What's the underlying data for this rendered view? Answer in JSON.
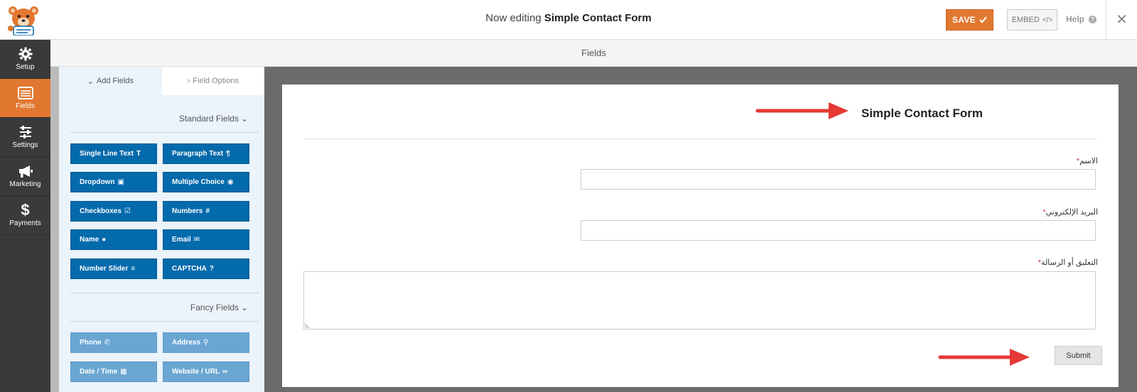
{
  "header": {
    "title_prefix": "Now editing",
    "title_form": "Simple Contact Form",
    "save_label": "SAVE",
    "embed_label": "EMBED",
    "help_label": "Help"
  },
  "sidebar": {
    "items": [
      {
        "label": "Setup",
        "icon": "gear-icon",
        "active": false
      },
      {
        "label": "Fields",
        "icon": "list-icon",
        "active": true
      },
      {
        "label": "Settings",
        "icon": "sliders-icon",
        "active": false
      },
      {
        "label": "Marketing",
        "icon": "megaphone-icon",
        "active": false
      },
      {
        "label": "Payments",
        "icon": "dollar-icon",
        "active": false
      }
    ]
  },
  "fields_header": "Fields",
  "panel": {
    "tabs": [
      {
        "label": "Add Fields",
        "active": true
      },
      {
        "label": "Field Options",
        "active": false
      }
    ],
    "standard_title": "Standard Fields",
    "fancy_title": "Fancy Fields",
    "standard_fields": [
      {
        "label": "Single Line Text",
        "icon": "text-cursor-icon"
      },
      {
        "label": "Paragraph Text",
        "icon": "pilcrow-icon"
      },
      {
        "label": "Dropdown",
        "icon": "dropdown-icon"
      },
      {
        "label": "Multiple Choice",
        "icon": "radio-icon"
      },
      {
        "label": "Checkboxes",
        "icon": "checkbox-icon"
      },
      {
        "label": "Numbers",
        "icon": "hash-icon"
      },
      {
        "label": "Name",
        "icon": "user-icon"
      },
      {
        "label": "Email",
        "icon": "envelope-icon"
      },
      {
        "label": "Number Slider",
        "icon": "sliders-icon"
      },
      {
        "label": "CAPTCHA",
        "icon": "question-circle-icon"
      }
    ],
    "fancy_fields": [
      {
        "label": "Phone",
        "icon": "phone-icon"
      },
      {
        "label": "Address",
        "icon": "map-marker-icon"
      },
      {
        "label": "Date / Time",
        "icon": "calendar-icon"
      },
      {
        "label": "Website / URL",
        "icon": "link-icon"
      }
    ]
  },
  "form": {
    "title": "Simple Contact Form",
    "fields": [
      {
        "label": "الاسم",
        "required": true,
        "type": "text"
      },
      {
        "label": "البريد الإلكتروني",
        "required": true,
        "type": "email"
      },
      {
        "label": "التعليق أو الرسالة",
        "required": true,
        "type": "textarea"
      }
    ],
    "required_marker": "*",
    "submit_label": "Submit"
  },
  "colors": {
    "accent": "#e27730",
    "field_button": "#036aab",
    "fancy_button": "#6ba6d3",
    "annotation_arrow": "#e53935"
  }
}
